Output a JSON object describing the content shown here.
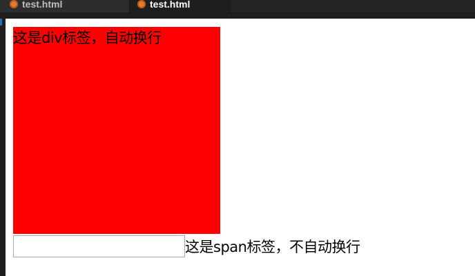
{
  "tabs": [
    {
      "label": "test.html",
      "icon": "html-file-icon",
      "active": false
    },
    {
      "label": "test.html",
      "icon": "html-file-icon",
      "active": true
    }
  ],
  "page": {
    "div_text": "这是div标签，自动换行",
    "span_text": "这是span标签，不自动换行",
    "input_value": ""
  },
  "colors": {
    "div_background": "#ff0000",
    "editor_chrome": "#1e1e1e",
    "file_icon": "#e37933"
  }
}
